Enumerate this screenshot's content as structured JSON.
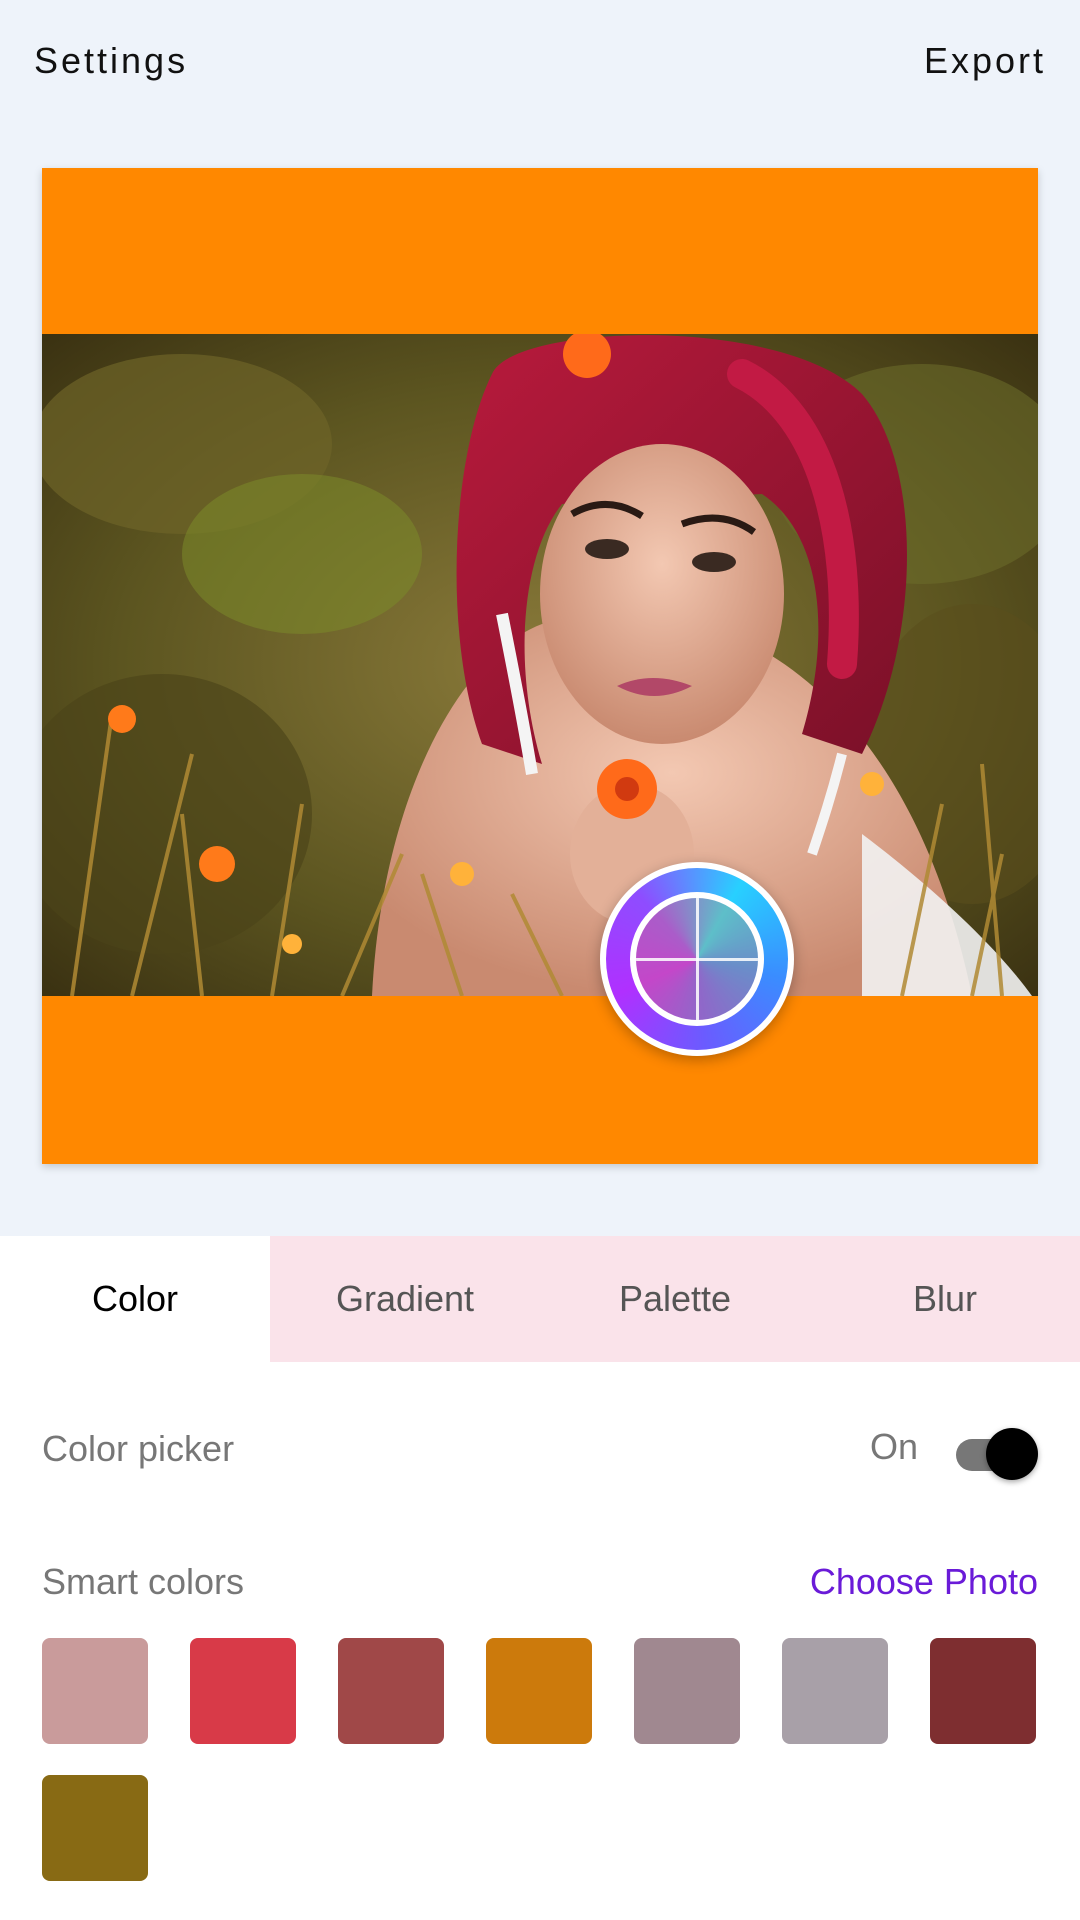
{
  "header": {
    "settings_label": "Settings",
    "export_label": "Export"
  },
  "canvas": {
    "background_color": "#ff8800"
  },
  "tabs": [
    {
      "label": "Color",
      "active": true
    },
    {
      "label": "Gradient",
      "active": false
    },
    {
      "label": "Palette",
      "active": false
    },
    {
      "label": "Blur",
      "active": false
    }
  ],
  "color_picker": {
    "label": "Color picker",
    "state_label": "On",
    "enabled": true
  },
  "smart_colors": {
    "label": "Smart colors",
    "action_label": "Choose Photo",
    "swatches": [
      "#c99b9b",
      "#d83a48",
      "#a04848",
      "#cc7a0c",
      "#a08890",
      "#a8a0a8",
      "#7e2e30",
      "#886a14"
    ]
  }
}
